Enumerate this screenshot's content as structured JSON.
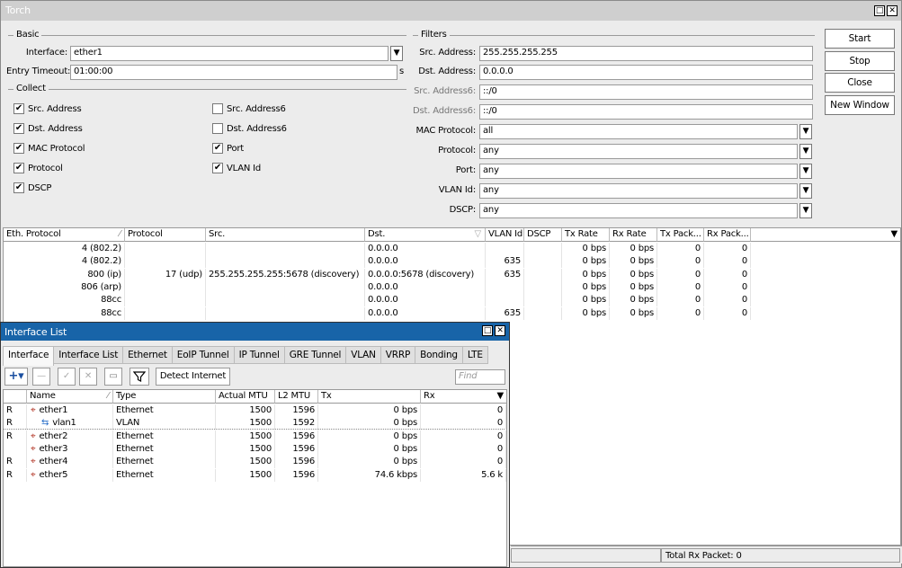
{
  "torch": {
    "title": "Torch",
    "basic_legend": "Basic",
    "interface_label": "Interface:",
    "interface_value": "ether1",
    "entry_timeout_label": "Entry Timeout:",
    "entry_timeout_value": "01:00:00",
    "entry_timeout_unit": "s",
    "collect_legend": "Collect",
    "collect": [
      {
        "label": "Src. Address",
        "checked": true
      },
      {
        "label": "Dst. Address",
        "checked": true
      },
      {
        "label": "MAC Protocol",
        "checked": true
      },
      {
        "label": "Protocol",
        "checked": true
      },
      {
        "label": "DSCP",
        "checked": true
      },
      {
        "label": "Src. Address6",
        "checked": false
      },
      {
        "label": "Dst. Address6",
        "checked": false
      },
      {
        "label": "Port",
        "checked": true
      },
      {
        "label": "VLAN Id",
        "checked": true
      }
    ],
    "filters_legend": "Filters",
    "filters": {
      "src_address_label": "Src. Address:",
      "src_address": "255.255.255.255",
      "dst_address_label": "Dst. Address:",
      "dst_address": "0.0.0.0",
      "src_address6_label": "Src. Address6:",
      "src_address6": "::/0",
      "dst_address6_label": "Dst. Address6:",
      "dst_address6": "::/0",
      "mac_protocol_label": "MAC Protocol:",
      "mac_protocol": "all",
      "protocol_label": "Protocol:",
      "protocol": "any",
      "port_label": "Port:",
      "port": "any",
      "vlan_id_label": "VLAN Id:",
      "vlan_id": "any",
      "dscp_label": "DSCP:",
      "dscp": "any"
    },
    "buttons": {
      "start": "Start",
      "stop": "Stop",
      "close": "Close",
      "new_window": "New Window"
    },
    "table_headers": [
      "Eth. Protocol",
      "Protocol",
      "Src.",
      "Dst.",
      "VLAN Id",
      "DSCP",
      "Tx Rate",
      "Rx Rate",
      "Tx Pack...",
      "Rx Pack..."
    ],
    "rows": [
      [
        "4 (802.2)",
        "",
        "",
        "0.0.0.0",
        "",
        "",
        "0 bps",
        "0 bps",
        "0",
        "0"
      ],
      [
        "4 (802.2)",
        "",
        "",
        "0.0.0.0",
        "635",
        "",
        "0 bps",
        "0 bps",
        "0",
        "0"
      ],
      [
        "800 (ip)",
        "17 (udp)",
        "255.255.255.255:5678 (discovery)",
        "0.0.0.0:5678 (discovery)",
        "635",
        "",
        "0 bps",
        "0 bps",
        "0",
        "0"
      ],
      [
        "806 (arp)",
        "",
        "",
        "0.0.0.0",
        "",
        "",
        "0 bps",
        "0 bps",
        "0",
        "0"
      ],
      [
        "88cc",
        "",
        "",
        "0.0.0.0",
        "",
        "",
        "0 bps",
        "0 bps",
        "0",
        "0"
      ],
      [
        "88cc",
        "",
        "",
        "0.0.0.0",
        "635",
        "",
        "0 bps",
        "0 bps",
        "0",
        "0"
      ]
    ],
    "status": "Total Rx Packet: 0"
  },
  "iflist": {
    "title": "Interface List",
    "tabs": [
      "Interface",
      "Interface List",
      "Ethernet",
      "EoIP Tunnel",
      "IP Tunnel",
      "GRE Tunnel",
      "VLAN",
      "VRRP",
      "Bonding",
      "LTE"
    ],
    "detect_internet": "Detect Internet",
    "find_placeholder": "Find",
    "headers": [
      "Name",
      "Type",
      "Actual MTU",
      "L2 MTU",
      "Tx",
      "Rx"
    ],
    "rows": [
      {
        "flag": "R",
        "name": "ether1",
        "type": "Ethernet",
        "mtu": "1500",
        "l2mtu": "1596",
        "tx": "0 bps",
        "rx": "0",
        "icon": "ethernet-icon"
      },
      {
        "flag": "R",
        "name": "vlan1",
        "type": "VLAN",
        "mtu": "1500",
        "l2mtu": "1592",
        "tx": "0 bps",
        "rx": "0",
        "icon": "vlan-icon"
      },
      {
        "flag": "R",
        "name": "ether2",
        "type": "Ethernet",
        "mtu": "1500",
        "l2mtu": "1596",
        "tx": "0 bps",
        "rx": "0",
        "icon": "ethernet-icon"
      },
      {
        "flag": "",
        "name": "ether3",
        "type": "Ethernet",
        "mtu": "1500",
        "l2mtu": "1596",
        "tx": "0 bps",
        "rx": "0",
        "icon": "ethernet-icon"
      },
      {
        "flag": "R",
        "name": "ether4",
        "type": "Ethernet",
        "mtu": "1500",
        "l2mtu": "1596",
        "tx": "0 bps",
        "rx": "0",
        "icon": "ethernet-icon"
      },
      {
        "flag": "R",
        "name": "ether5",
        "type": "Ethernet",
        "mtu": "1500",
        "l2mtu": "1596",
        "tx": "74.6 kbps",
        "rx": "5.6 k",
        "icon": "ethernet-icon"
      }
    ]
  }
}
